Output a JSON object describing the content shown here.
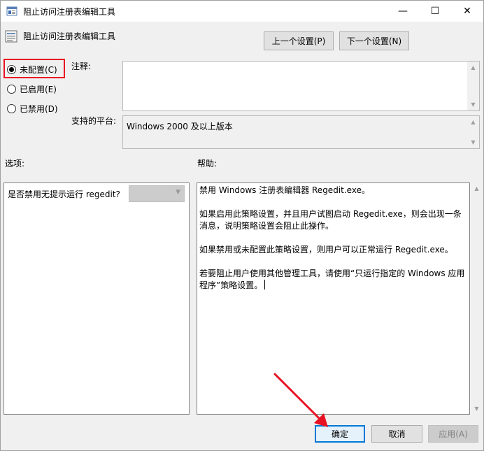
{
  "window": {
    "title": "阻止访问注册表编辑工具",
    "controls": {
      "minimize": "—",
      "maximize": "☐",
      "close": "✕"
    }
  },
  "header": {
    "policy_name": "阻止访问注册表编辑工具",
    "prev_label": "上一个设置(P)",
    "next_label": "下一个设置(N)"
  },
  "state": {
    "options": [
      {
        "label": "未配置(C)",
        "checked": true
      },
      {
        "label": "已启用(E)",
        "checked": false
      },
      {
        "label": "已禁用(D)",
        "checked": false
      }
    ]
  },
  "comment": {
    "label": "注释:",
    "value": ""
  },
  "platform": {
    "label": "支持的平台:",
    "value": "Windows 2000 及以上版本"
  },
  "options_section": {
    "label": "选项:",
    "question": "是否禁用无提示运行 regedit?",
    "select_value": ""
  },
  "help_section": {
    "label": "帮助:",
    "paragraphs": [
      "禁用 Windows 注册表编辑器 Regedit.exe。",
      "如果启用此策略设置，并且用户试图启动 Regedit.exe，则会出现一条消息，说明策略设置会阻止此操作。",
      "如果禁用或未配置此策略设置，则用户可以正常运行 Regedit.exe。",
      "若要阻止用户使用其他管理工具，请使用“只运行指定的 Windows 应用程序”策略设置。"
    ]
  },
  "footer": {
    "ok_label": "确定",
    "cancel_label": "取消",
    "apply_label": "应用(A)"
  },
  "colors": {
    "highlight": "#e81123",
    "focus_border": "#0078d7"
  },
  "icons": [
    "app-icon",
    "policy-icon",
    "chevron-down-icon",
    "scroll-up-icon",
    "scroll-down-icon",
    "red-arrow-annotation"
  ]
}
